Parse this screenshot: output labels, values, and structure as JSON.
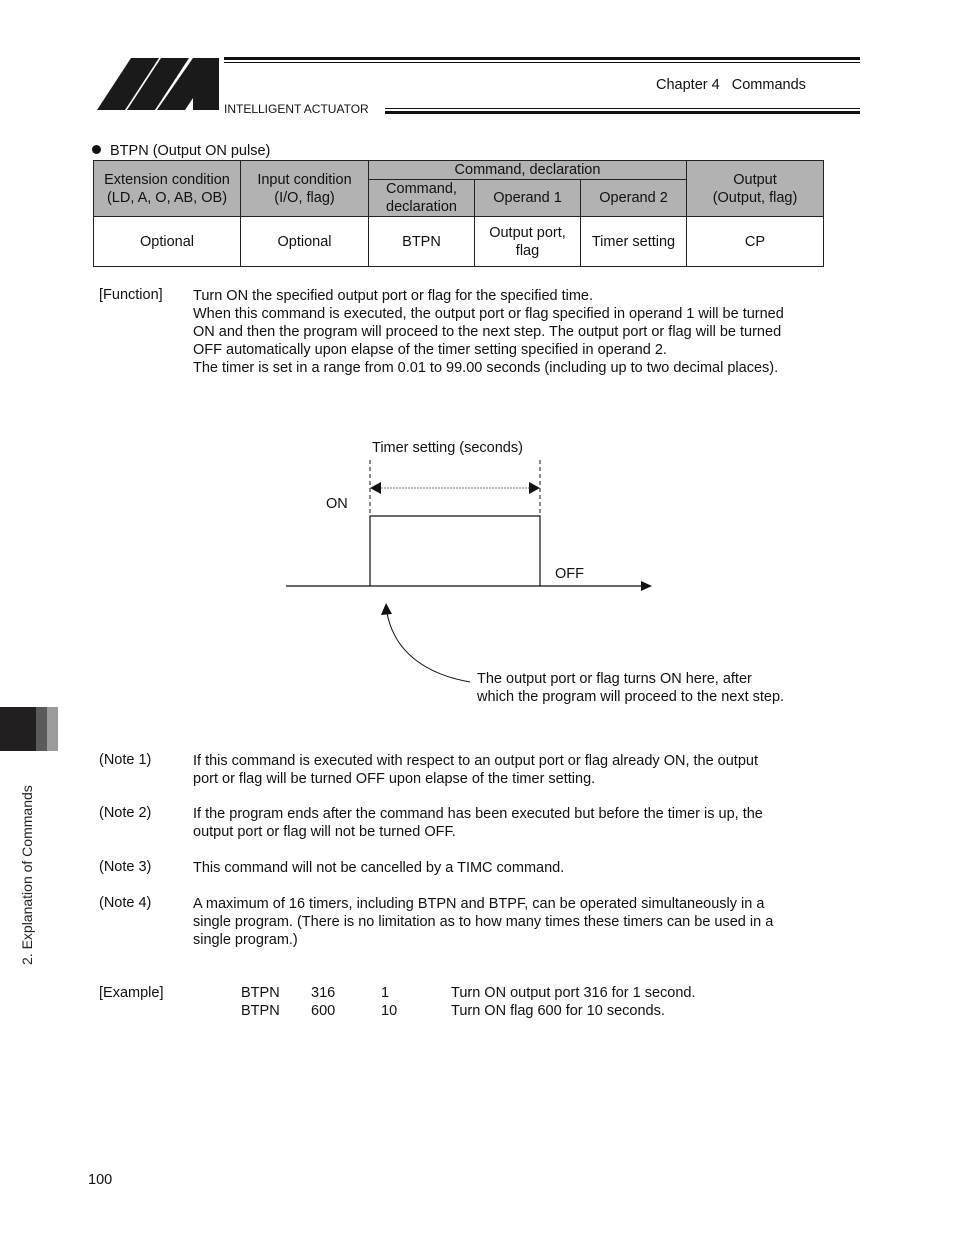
{
  "header": {
    "brand": "INTELLIGENT ACTUATOR",
    "chapter": "Chapter 4   Commands",
    "logo": "iai-logo"
  },
  "section": {
    "bullet_title": "BTPN (Output ON pulse)"
  },
  "spec_table": {
    "headers": {
      "extension": [
        "Extension condition",
        "(LD, A, O, AB, OB)"
      ],
      "input": [
        "Input condition",
        "(I/O, flag)"
      ],
      "command_group": "Command, declaration",
      "command": [
        "Command,",
        "declaration"
      ],
      "operand1": "Operand 1",
      "operand2": "Operand 2",
      "output": [
        "Output",
        "(Output, flag)"
      ]
    },
    "row": {
      "extension": "Optional",
      "input": "Optional",
      "command": "BTPN",
      "operand1": [
        "Output port,",
        "flag"
      ],
      "operand2": "Timer setting",
      "output": "CP"
    }
  },
  "function": {
    "label": "[Function]",
    "lines": [
      "Turn ON the specified output port or flag for the specified time.",
      "When this command is executed, the output port or flag specified in operand 1 will be turned",
      "ON and then the program will proceed to the next step. The output port or flag will be turned",
      "OFF automatically upon elapse of the timer setting specified in operand 2.",
      "The timer is set in a range from 0.01 to 99.00 seconds (including up to two decimal places)."
    ]
  },
  "diagram": {
    "timer_label": "Timer setting (seconds)",
    "on_label": "ON",
    "off_label": "OFF",
    "callout": [
      "The output port or flag turns ON here, after",
      "which the program will proceed to the next step."
    ]
  },
  "notes": [
    {
      "label": "(Note 1)",
      "lines": [
        "If this command is executed with respect to an output port or flag already ON, the output",
        "port or flag will be turned OFF upon elapse of the timer setting."
      ]
    },
    {
      "label": "(Note 2)",
      "lines": [
        "If the program ends after the command has been executed but before the timer is up, the",
        "output port or flag will not be turned OFF."
      ]
    },
    {
      "label": "(Note 3)",
      "lines": [
        "This command will not be cancelled by a TIMC command."
      ]
    },
    {
      "label": "(Note 4)",
      "lines": [
        "A maximum of 16 timers, including BTPN and BTPF, can be operated simultaneously in a",
        "single program. (There is no limitation as to how many times these timers can be used in a",
        "single program.)"
      ]
    }
  ],
  "example": {
    "label": "[Example]",
    "rows": [
      {
        "cmd": "BTPN",
        "op1": "316",
        "op2": "1",
        "desc": "Turn ON output port 316 for 1 second."
      },
      {
        "cmd": "BTPN",
        "op1": "600",
        "op2": "10",
        "desc": "Turn ON flag 600 for 10 seconds."
      }
    ]
  },
  "side_tab": "2. Explanation of Commands",
  "page_number": "100"
}
